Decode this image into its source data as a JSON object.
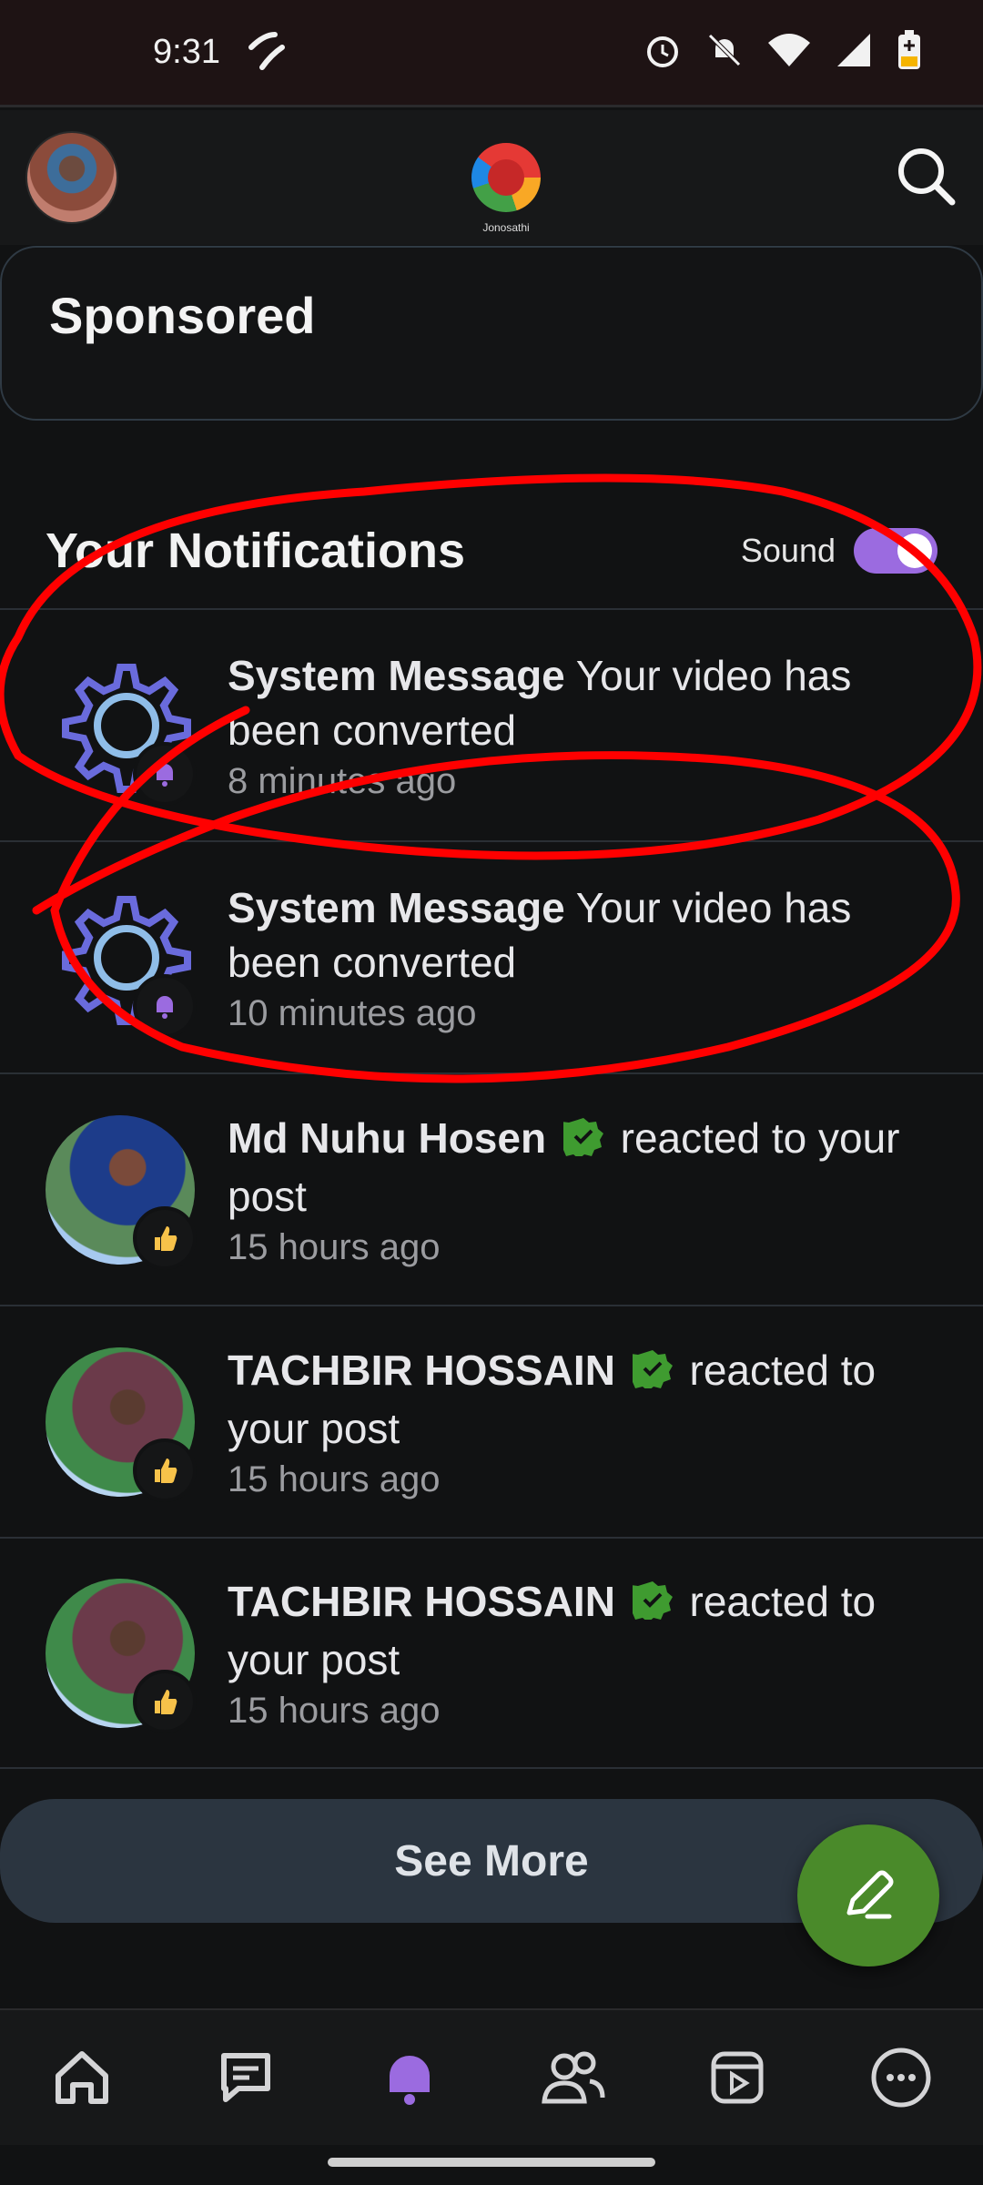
{
  "status_bar": {
    "time": "9:31",
    "icons": [
      "carrier-icon",
      "alarm-icon",
      "bell-off-icon",
      "wifi-icon",
      "signal-icon",
      "battery-charging-icon"
    ]
  },
  "top_bar": {
    "logo_text": "Jonosathi",
    "search_icon": "search-icon"
  },
  "sponsored": {
    "title": "Sponsored"
  },
  "notifications": {
    "title": "Your Notifications",
    "sound_label": "Sound",
    "sound_enabled": true,
    "items": [
      {
        "name": "System Message",
        "message": "Your video has been converted",
        "time": "8 minutes ago",
        "icon": "gear-icon",
        "badge": "bell-icon"
      },
      {
        "name": "System Message",
        "message": "Your video has been converted",
        "time": "10 minutes ago",
        "icon": "gear-icon",
        "badge": "bell-icon"
      },
      {
        "name": "Md Nuhu Hosen",
        "message": "reacted to your post",
        "time": "15 hours ago",
        "icon": "avatar",
        "badge": "thumbs-up-icon",
        "verified": true
      },
      {
        "name": "TACHBIR HOSSAIN",
        "message": "reacted to your post",
        "time": "15 hours ago",
        "icon": "avatar",
        "badge": "thumbs-up-icon",
        "verified": true
      },
      {
        "name": "TACHBIR HOSSAIN",
        "message": "reacted to your post",
        "time": "15 hours ago",
        "icon": "avatar",
        "badge": "thumbs-up-icon",
        "verified": true
      }
    ]
  },
  "see_more_label": "See More",
  "bottom_nav": [
    "home-icon",
    "chat-icon",
    "bell-icon",
    "people-icon",
    "video-icon",
    "more-icon"
  ],
  "colors": {
    "accent": "#9b6be0",
    "fab": "#4a8a2a",
    "verified": "#3f9b30",
    "annotation": "#ff0000"
  }
}
